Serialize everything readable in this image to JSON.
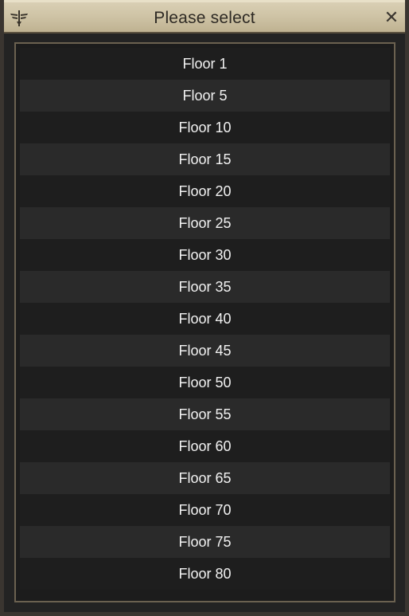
{
  "window": {
    "title": "Please select",
    "close_label": "✕"
  },
  "options": [
    "Floor 1",
    "Floor 5",
    "Floor 10",
    "Floor 15",
    "Floor 20",
    "Floor 25",
    "Floor 30",
    "Floor 35",
    "Floor 40",
    "Floor 45",
    "Floor 50",
    "Floor 55",
    "Floor 60",
    "Floor 65",
    "Floor 70",
    "Floor 75",
    "Floor 80"
  ],
  "colors": {
    "title_bar": "#cfc4a6",
    "row_dark": "#1e1e1e",
    "row_light": "#2a2a2a",
    "text": "#f2f2f2"
  }
}
